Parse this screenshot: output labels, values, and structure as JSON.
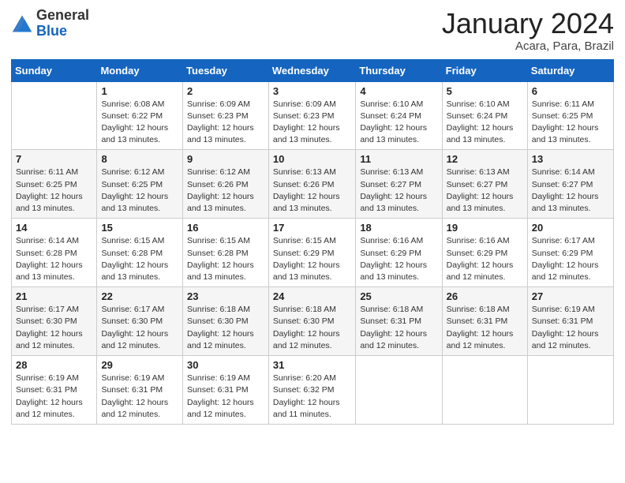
{
  "logo": {
    "general": "General",
    "blue": "Blue"
  },
  "title": {
    "month_year": "January 2024",
    "location": "Acara, Para, Brazil"
  },
  "days_of_week": [
    "Sunday",
    "Monday",
    "Tuesday",
    "Wednesday",
    "Thursday",
    "Friday",
    "Saturday"
  ],
  "weeks": [
    [
      {
        "day": "",
        "sunrise": "",
        "sunset": "",
        "daylight": ""
      },
      {
        "day": "1",
        "sunrise": "Sunrise: 6:08 AM",
        "sunset": "Sunset: 6:22 PM",
        "daylight": "Daylight: 12 hours and 13 minutes."
      },
      {
        "day": "2",
        "sunrise": "Sunrise: 6:09 AM",
        "sunset": "Sunset: 6:23 PM",
        "daylight": "Daylight: 12 hours and 13 minutes."
      },
      {
        "day": "3",
        "sunrise": "Sunrise: 6:09 AM",
        "sunset": "Sunset: 6:23 PM",
        "daylight": "Daylight: 12 hours and 13 minutes."
      },
      {
        "day": "4",
        "sunrise": "Sunrise: 6:10 AM",
        "sunset": "Sunset: 6:24 PM",
        "daylight": "Daylight: 12 hours and 13 minutes."
      },
      {
        "day": "5",
        "sunrise": "Sunrise: 6:10 AM",
        "sunset": "Sunset: 6:24 PM",
        "daylight": "Daylight: 12 hours and 13 minutes."
      },
      {
        "day": "6",
        "sunrise": "Sunrise: 6:11 AM",
        "sunset": "Sunset: 6:25 PM",
        "daylight": "Daylight: 12 hours and 13 minutes."
      }
    ],
    [
      {
        "day": "7",
        "sunrise": "Sunrise: 6:11 AM",
        "sunset": "Sunset: 6:25 PM",
        "daylight": "Daylight: 12 hours and 13 minutes."
      },
      {
        "day": "8",
        "sunrise": "Sunrise: 6:12 AM",
        "sunset": "Sunset: 6:25 PM",
        "daylight": "Daylight: 12 hours and 13 minutes."
      },
      {
        "day": "9",
        "sunrise": "Sunrise: 6:12 AM",
        "sunset": "Sunset: 6:26 PM",
        "daylight": "Daylight: 12 hours and 13 minutes."
      },
      {
        "day": "10",
        "sunrise": "Sunrise: 6:13 AM",
        "sunset": "Sunset: 6:26 PM",
        "daylight": "Daylight: 12 hours and 13 minutes."
      },
      {
        "day": "11",
        "sunrise": "Sunrise: 6:13 AM",
        "sunset": "Sunset: 6:27 PM",
        "daylight": "Daylight: 12 hours and 13 minutes."
      },
      {
        "day": "12",
        "sunrise": "Sunrise: 6:13 AM",
        "sunset": "Sunset: 6:27 PM",
        "daylight": "Daylight: 12 hours and 13 minutes."
      },
      {
        "day": "13",
        "sunrise": "Sunrise: 6:14 AM",
        "sunset": "Sunset: 6:27 PM",
        "daylight": "Daylight: 12 hours and 13 minutes."
      }
    ],
    [
      {
        "day": "14",
        "sunrise": "Sunrise: 6:14 AM",
        "sunset": "Sunset: 6:28 PM",
        "daylight": "Daylight: 12 hours and 13 minutes."
      },
      {
        "day": "15",
        "sunrise": "Sunrise: 6:15 AM",
        "sunset": "Sunset: 6:28 PM",
        "daylight": "Daylight: 12 hours and 13 minutes."
      },
      {
        "day": "16",
        "sunrise": "Sunrise: 6:15 AM",
        "sunset": "Sunset: 6:28 PM",
        "daylight": "Daylight: 12 hours and 13 minutes."
      },
      {
        "day": "17",
        "sunrise": "Sunrise: 6:15 AM",
        "sunset": "Sunset: 6:29 PM",
        "daylight": "Daylight: 12 hours and 13 minutes."
      },
      {
        "day": "18",
        "sunrise": "Sunrise: 6:16 AM",
        "sunset": "Sunset: 6:29 PM",
        "daylight": "Daylight: 12 hours and 13 minutes."
      },
      {
        "day": "19",
        "sunrise": "Sunrise: 6:16 AM",
        "sunset": "Sunset: 6:29 PM",
        "daylight": "Daylight: 12 hours and 12 minutes."
      },
      {
        "day": "20",
        "sunrise": "Sunrise: 6:17 AM",
        "sunset": "Sunset: 6:29 PM",
        "daylight": "Daylight: 12 hours and 12 minutes."
      }
    ],
    [
      {
        "day": "21",
        "sunrise": "Sunrise: 6:17 AM",
        "sunset": "Sunset: 6:30 PM",
        "daylight": "Daylight: 12 hours and 12 minutes."
      },
      {
        "day": "22",
        "sunrise": "Sunrise: 6:17 AM",
        "sunset": "Sunset: 6:30 PM",
        "daylight": "Daylight: 12 hours and 12 minutes."
      },
      {
        "day": "23",
        "sunrise": "Sunrise: 6:18 AM",
        "sunset": "Sunset: 6:30 PM",
        "daylight": "Daylight: 12 hours and 12 minutes."
      },
      {
        "day": "24",
        "sunrise": "Sunrise: 6:18 AM",
        "sunset": "Sunset: 6:30 PM",
        "daylight": "Daylight: 12 hours and 12 minutes."
      },
      {
        "day": "25",
        "sunrise": "Sunrise: 6:18 AM",
        "sunset": "Sunset: 6:31 PM",
        "daylight": "Daylight: 12 hours and 12 minutes."
      },
      {
        "day": "26",
        "sunrise": "Sunrise: 6:18 AM",
        "sunset": "Sunset: 6:31 PM",
        "daylight": "Daylight: 12 hours and 12 minutes."
      },
      {
        "day": "27",
        "sunrise": "Sunrise: 6:19 AM",
        "sunset": "Sunset: 6:31 PM",
        "daylight": "Daylight: 12 hours and 12 minutes."
      }
    ],
    [
      {
        "day": "28",
        "sunrise": "Sunrise: 6:19 AM",
        "sunset": "Sunset: 6:31 PM",
        "daylight": "Daylight: 12 hours and 12 minutes."
      },
      {
        "day": "29",
        "sunrise": "Sunrise: 6:19 AM",
        "sunset": "Sunset: 6:31 PM",
        "daylight": "Daylight: 12 hours and 12 minutes."
      },
      {
        "day": "30",
        "sunrise": "Sunrise: 6:19 AM",
        "sunset": "Sunset: 6:31 PM",
        "daylight": "Daylight: 12 hours and 12 minutes."
      },
      {
        "day": "31",
        "sunrise": "Sunrise: 6:20 AM",
        "sunset": "Sunset: 6:32 PM",
        "daylight": "Daylight: 12 hours and 11 minutes."
      },
      {
        "day": "",
        "sunrise": "",
        "sunset": "",
        "daylight": ""
      },
      {
        "day": "",
        "sunrise": "",
        "sunset": "",
        "daylight": ""
      },
      {
        "day": "",
        "sunrise": "",
        "sunset": "",
        "daylight": ""
      }
    ]
  ]
}
